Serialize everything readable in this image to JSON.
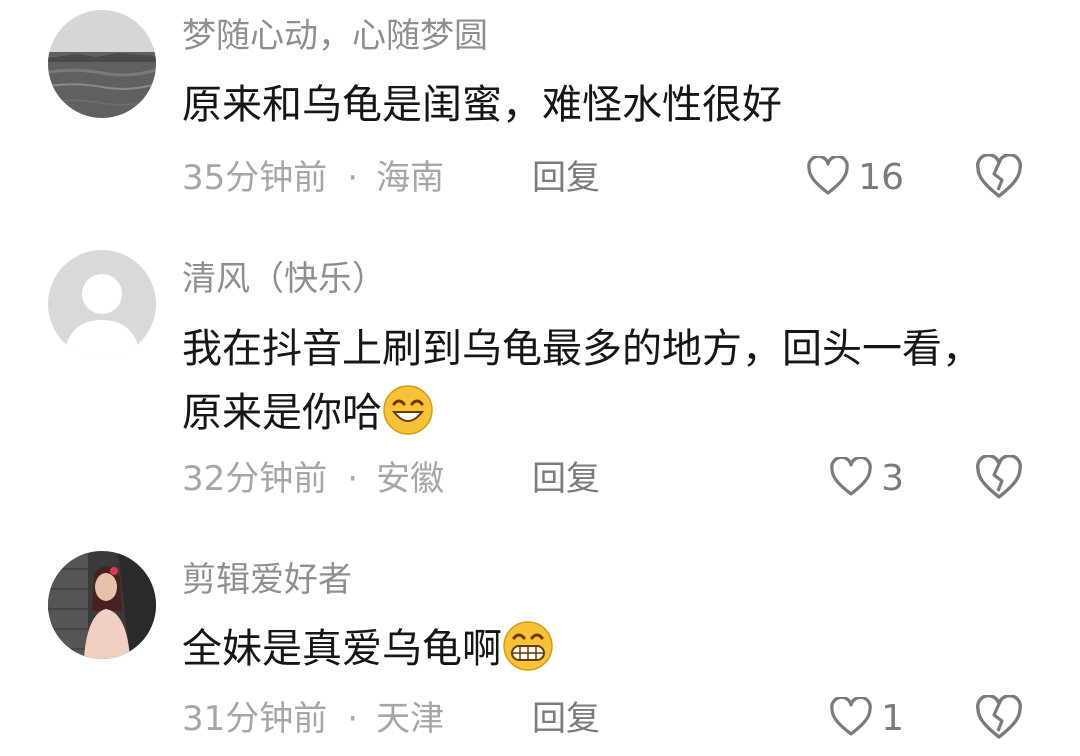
{
  "comments": [
    {
      "username": "梦随心动，心随梦圆",
      "text": "原来和乌龟是闺蜜，难怪水性很好",
      "emoji": "",
      "time": "35分钟前",
      "separator": "·",
      "location": "海南",
      "reply_label": "回复",
      "like_count": "16",
      "avatar": "landscape-photo"
    },
    {
      "username": "清风（快乐）",
      "text": "我在抖音上刷到乌龟最多的地方，回头一看，原来是你哈",
      "emoji": "smile-emoji",
      "time": "32分钟前",
      "separator": "·",
      "location": "安徽",
      "reply_label": "回复",
      "like_count": "3",
      "avatar": "default-user"
    },
    {
      "username": "剪辑爱好者",
      "text": "全妹是真爱乌龟啊",
      "emoji": "grin-emoji",
      "time": "31分钟前",
      "separator": "·",
      "location": "天津",
      "reply_label": "回复",
      "like_count": "1",
      "avatar": "person-photo"
    }
  ],
  "icons": {
    "like": "heart-outline-icon",
    "dislike": "broken-heart-icon"
  },
  "colors": {
    "username": "#8f8f8f",
    "text": "#161616",
    "meta": "#a6a6a6",
    "icon": "#7b7b7b",
    "emoji": "#f7c235"
  }
}
